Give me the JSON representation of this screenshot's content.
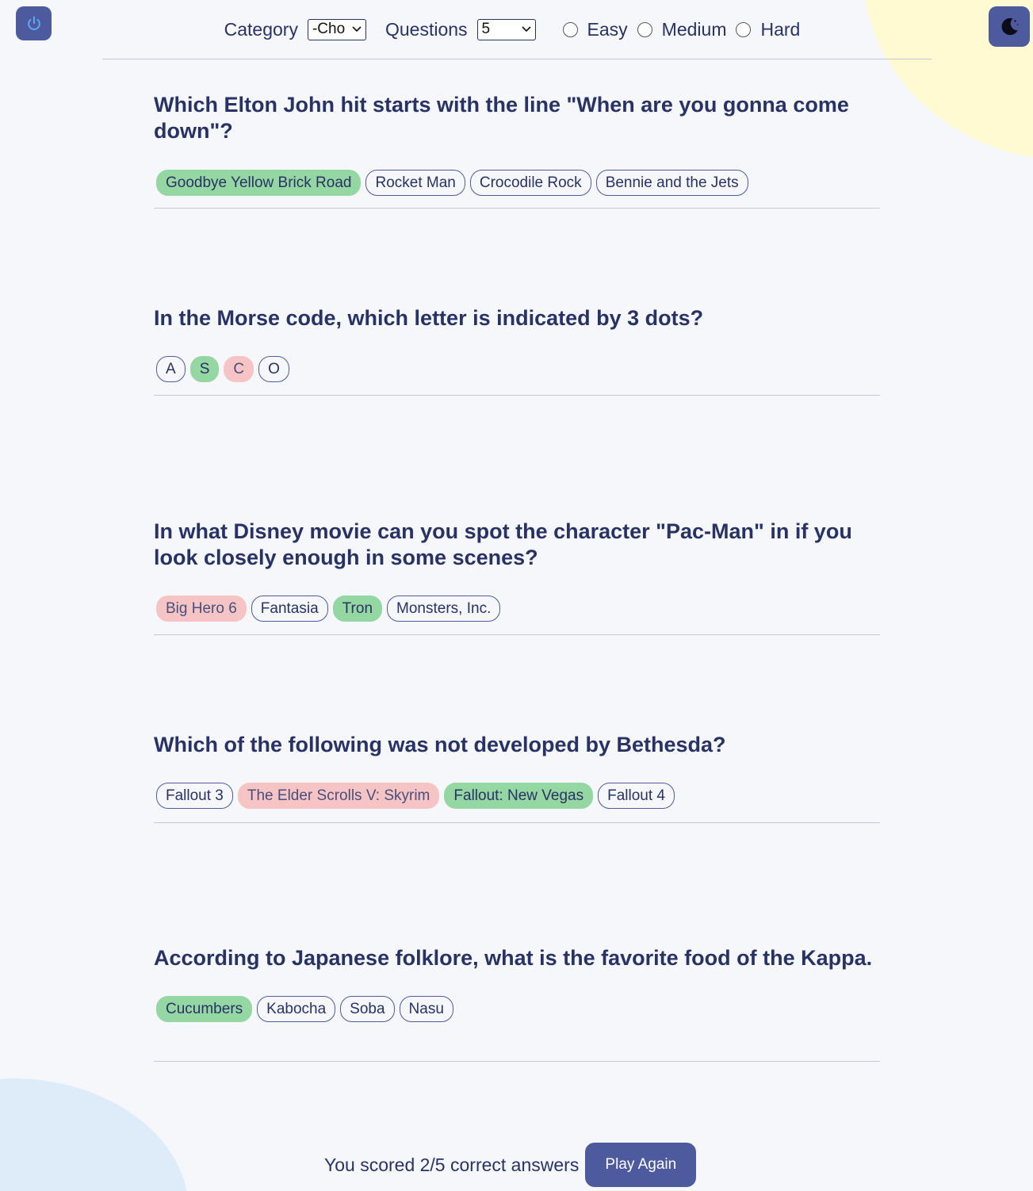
{
  "header": {
    "category_label": "Category",
    "category_value": "-Cho",
    "questions_label": "Questions",
    "questions_value": "5",
    "difficulty": [
      "Easy",
      "Medium",
      "Hard"
    ]
  },
  "icons": {
    "power": "power-icon",
    "theme": "moon-icon"
  },
  "questions": [
    {
      "text": "Which Elton John hit starts with the line \"When are you gonna come down\"?",
      "answers": [
        {
          "label": "Goodbye Yellow Brick Road",
          "state": "correct"
        },
        {
          "label": "Rocket Man",
          "state": "none"
        },
        {
          "label": "Crocodile Rock",
          "state": "none"
        },
        {
          "label": "Bennie and the Jets",
          "state": "none"
        }
      ]
    },
    {
      "text": "In the Morse code, which letter is indicated by 3 dots?",
      "answers": [
        {
          "label": "A",
          "state": "none"
        },
        {
          "label": "S",
          "state": "correct"
        },
        {
          "label": "C",
          "state": "wrong"
        },
        {
          "label": "O",
          "state": "none"
        }
      ]
    },
    {
      "text": "In what Disney movie can you spot the character \"Pac-Man\" in if you look closely enough in some scenes?",
      "answers": [
        {
          "label": "Big Hero 6",
          "state": "wrong"
        },
        {
          "label": "Fantasia",
          "state": "none"
        },
        {
          "label": "Tron",
          "state": "correct"
        },
        {
          "label": "Monsters, Inc.",
          "state": "none"
        }
      ]
    },
    {
      "text": "Which of the following was not developed by Bethesda?",
      "answers": [
        {
          "label": "Fallout 3",
          "state": "none"
        },
        {
          "label": "The Elder Scrolls V: Skyrim",
          "state": "wrong"
        },
        {
          "label": "Fallout: New Vegas",
          "state": "correct"
        },
        {
          "label": "Fallout 4",
          "state": "none"
        }
      ]
    },
    {
      "text": "According to Japanese folklore, what is the favorite food of the Kappa.",
      "answers": [
        {
          "label": "Cucumbers",
          "state": "correct"
        },
        {
          "label": "Kabocha",
          "state": "none"
        },
        {
          "label": "Soba",
          "state": "none"
        },
        {
          "label": "Nasu",
          "state": "none"
        }
      ]
    }
  ],
  "footer": {
    "score_text": "You scored 2/5 correct answers",
    "play_again": "Play Again"
  }
}
